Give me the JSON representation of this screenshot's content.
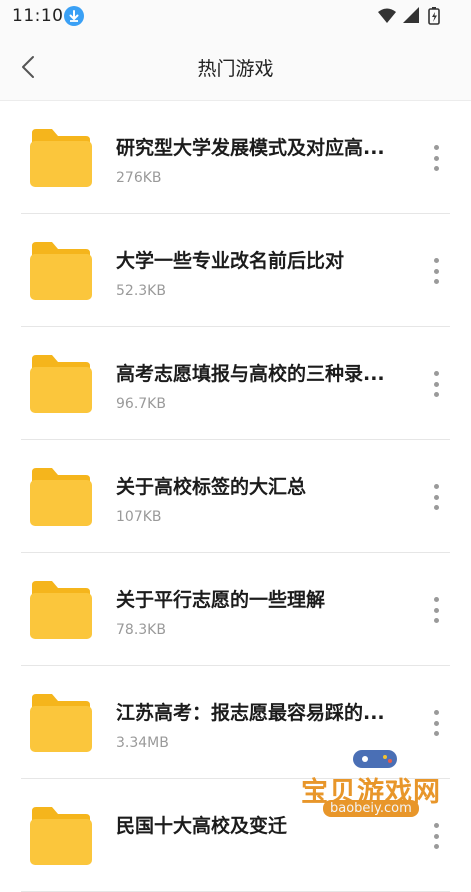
{
  "status_bar": {
    "time": "11:10"
  },
  "header": {
    "title": "热门游戏"
  },
  "files": [
    {
      "name": "研究型大学发展模式及对应高...",
      "size": "276KB"
    },
    {
      "name": "大学一些专业改名前后比对",
      "size": "52.3KB"
    },
    {
      "name": "高考志愿填报与高校的三种录...",
      "size": "96.7KB"
    },
    {
      "name": "关于高校标签的大汇总",
      "size": "107KB"
    },
    {
      "name": "关于平行志愿的一些理解",
      "size": "78.3KB"
    },
    {
      "name": "江苏高考：报志愿最容易踩的...",
      "size": "3.34MB"
    },
    {
      "name": "民国十大高校及变迁",
      "size": ""
    }
  ],
  "watermark": {
    "title": "宝贝游戏网",
    "url": "baobeiy.com"
  },
  "colors": {
    "folder": "#fbc63c",
    "folder_tab": "#f5b51c",
    "accent": "#3aa0f5"
  },
  "icons": {
    "back": "chevron-left-icon",
    "folder": "folder-icon",
    "more": "more-vertical-icon"
  }
}
